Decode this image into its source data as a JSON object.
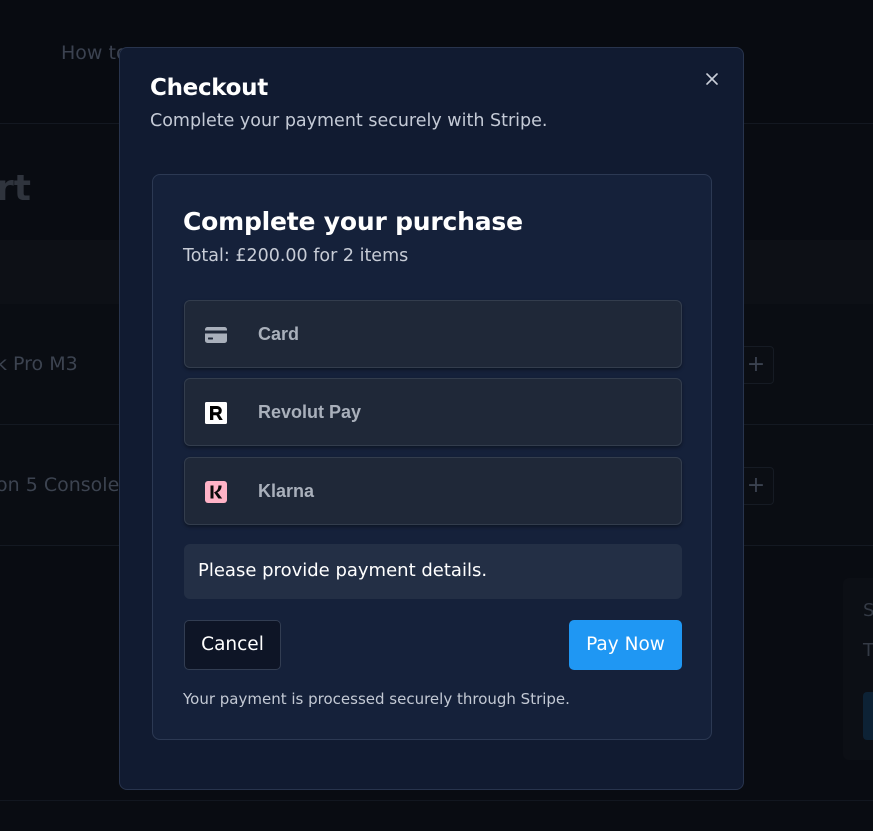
{
  "background": {
    "nav_text": "How to",
    "heading": "rt",
    "rows": [
      {
        "label": "k Pro M3"
      },
      {
        "label": "on 5 Console"
      }
    ],
    "plus_symbol": "+",
    "side_card": {
      "line1": "S",
      "line2": "T"
    }
  },
  "modal": {
    "title": "Checkout",
    "subtitle": "Complete your payment securely with Stripe.",
    "close_icon": "close-icon",
    "card": {
      "title": "Complete your purchase",
      "total_text": "Total: £200.00 for 2 items",
      "payment_methods": [
        {
          "label": "Card",
          "icon": "credit-card-icon"
        },
        {
          "label": "Revolut Pay",
          "icon": "revolut-icon"
        },
        {
          "label": "Klarna",
          "icon": "klarna-icon"
        }
      ],
      "status_message": "Please provide payment details.",
      "cancel_label": "Cancel",
      "pay_label": "Pay Now",
      "secure_note": "Your payment is processed securely through Stripe."
    }
  },
  "colors": {
    "accent": "#1f97f3",
    "modal_bg": "#111b31",
    "card_bg": "#15213a",
    "klarna_pink": "#ffb3c7"
  }
}
